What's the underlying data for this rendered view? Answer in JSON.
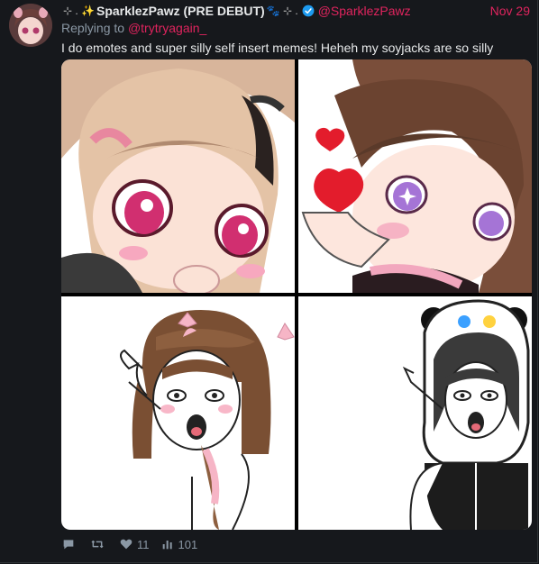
{
  "post": {
    "display_name": "SparklezPawz (PRE DEBUT)",
    "name_prefix_deco": "⊹ . ✨",
    "name_suffix_deco": "🐾 ⊹ .",
    "handle": "@SparklezPawz",
    "date": "Nov 29",
    "replying_prefix": "Replying to",
    "replying_to": "@trytryagain_",
    "text": "I do emotes and super silly self insert memes! Heheh my soyjacks are so silly",
    "verified_icon": "verified-badge-icon"
  },
  "media": [
    {
      "label": "emote-thinking"
    },
    {
      "label": "emote-finger-heart"
    },
    {
      "label": "soyjak-brown-hair"
    },
    {
      "label": "soyjak-panda-hood"
    }
  ],
  "actions": {
    "reply_count": "",
    "retweet_count": "",
    "like_count": "11",
    "views_count": "101"
  },
  "colors": {
    "accent": "#e0245e",
    "background": "#16181c",
    "muted": "#8b98a5",
    "text": "#e7e9ea",
    "verified": "#1d9bf0"
  }
}
